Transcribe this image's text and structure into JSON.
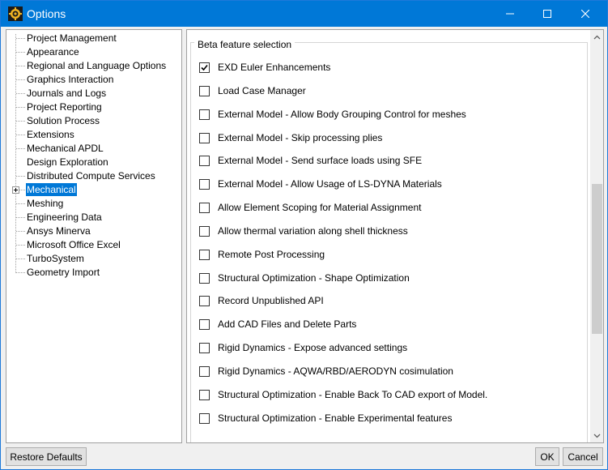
{
  "window": {
    "title": "Options",
    "app_icon": "ansys-gear-icon"
  },
  "tree": {
    "items": [
      {
        "label": "Project Management"
      },
      {
        "label": "Appearance"
      },
      {
        "label": "Regional and Language Options"
      },
      {
        "label": "Graphics Interaction"
      },
      {
        "label": "Journals and Logs"
      },
      {
        "label": "Project Reporting"
      },
      {
        "label": "Solution Process"
      },
      {
        "label": "Extensions"
      },
      {
        "label": "Mechanical APDL"
      },
      {
        "label": "Design Exploration",
        "expandable": true
      },
      {
        "label": "Distributed Compute Services"
      },
      {
        "label": "Mechanical",
        "selected": true
      },
      {
        "label": "Meshing"
      },
      {
        "label": "Engineering Data"
      },
      {
        "label": "Ansys Minerva"
      },
      {
        "label": "Microsoft Office Excel"
      },
      {
        "label": "TurboSystem"
      },
      {
        "label": "Geometry Import"
      }
    ]
  },
  "beta": {
    "group_label": "Beta feature selection",
    "features": [
      {
        "label": "EXD Euler Enhancements",
        "checked": true
      },
      {
        "label": "Load Case Manager",
        "checked": false
      },
      {
        "label": "External Model - Allow Body Grouping Control for meshes",
        "checked": false
      },
      {
        "label": "External Model - Skip processing plies",
        "checked": false
      },
      {
        "label": "External Model - Send surface loads using SFE",
        "checked": false
      },
      {
        "label": "External Model - Allow Usage of LS-DYNA Materials",
        "checked": false
      },
      {
        "label": "Allow Element Scoping for Material Assignment",
        "checked": false
      },
      {
        "label": "Allow thermal variation along shell thickness",
        "checked": false
      },
      {
        "label": "Remote Post Processing",
        "checked": false
      },
      {
        "label": "Structural Optimization - Shape Optimization",
        "checked": false
      },
      {
        "label": "Record Unpublished API",
        "checked": false
      },
      {
        "label": "Add CAD Files and Delete Parts",
        "checked": false
      },
      {
        "label": "Rigid Dynamics - Expose advanced settings",
        "checked": false
      },
      {
        "label": "Rigid Dynamics - AQWA/RBD/AERODYN cosimulation",
        "checked": false
      },
      {
        "label": "Structural Optimization - Enable Back To CAD export of Model.",
        "checked": false
      },
      {
        "label": "Structural Optimization - Enable Experimental features",
        "checked": false
      }
    ]
  },
  "buttons": {
    "restore_defaults": "Restore Defaults",
    "ok": "OK",
    "cancel": "Cancel"
  },
  "colors": {
    "titlebar": "#0078d7",
    "selection": "#0078d7"
  }
}
